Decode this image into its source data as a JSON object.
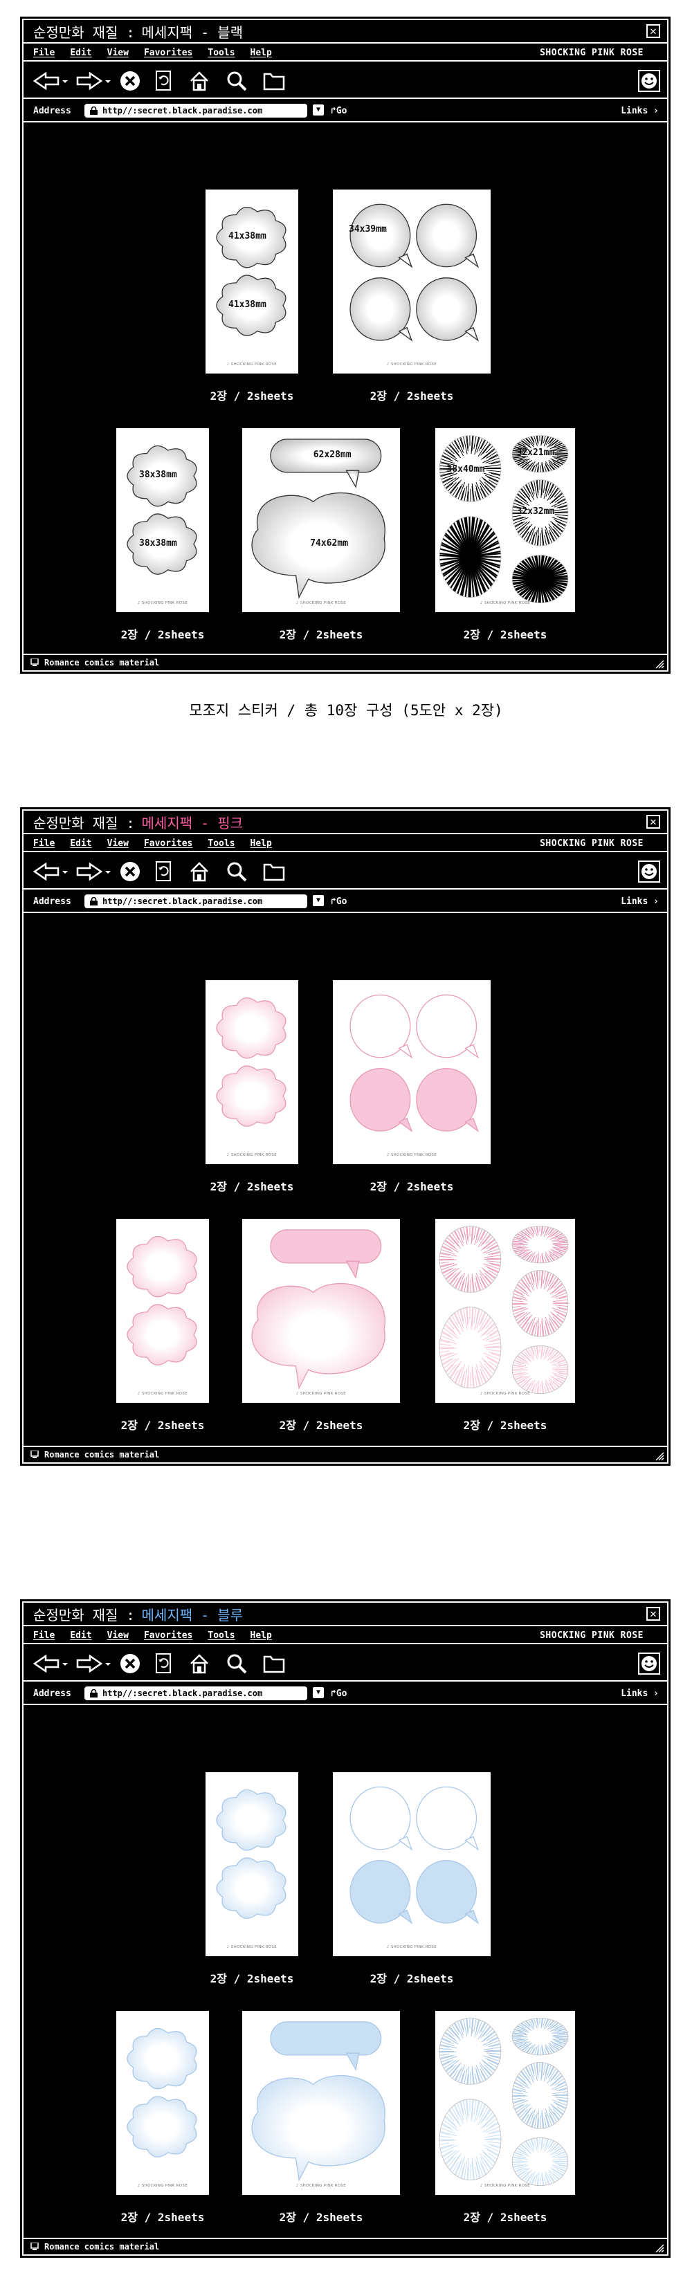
{
  "caption_text": "모조지 스티커 / 총 10장 구성 (5도안 x 2장)",
  "menu": [
    "File",
    "Edit",
    "View",
    "Favorites",
    "Tools",
    "Help"
  ],
  "brand": "SHOCKING PINK ROSE",
  "address_label": "Address",
  "url": "http//:secret.black.paradise.com",
  "go_label": "Go",
  "links_label": "Links",
  "status_text": "Romance comics material",
  "card_brand": "♪ SHOCKING PINK ROSE",
  "sheet_caption": "2장 / 2sheets",
  "windows": [
    {
      "title_main": "순정만화 재질 :",
      "title_variant": "메세지팩 - 블랙",
      "variant_color": "#ffffff",
      "tint": "#bfbfbf",
      "stroke": "#333333",
      "labels": [
        "41x38mm",
        "41x38mm",
        "34x39mm",
        "38x38mm",
        "38x38mm",
        "62x28mm",
        "74x62mm",
        "38x40mm",
        "32x21mm",
        "32x32mm"
      ]
    },
    {
      "title_main": "순정만화 재질 :",
      "title_variant": "메세지팩 - 핑크",
      "variant_color": "#ff5fa2",
      "tint": "#f7c6d8",
      "stroke": "#e79ab8",
      "labels": []
    },
    {
      "title_main": "순정만화 재질 :",
      "title_variant": "메세지팩 - 블루",
      "variant_color": "#6fb6ff",
      "tint": "#c9dff4",
      "stroke": "#a9c7e6",
      "labels": []
    }
  ]
}
